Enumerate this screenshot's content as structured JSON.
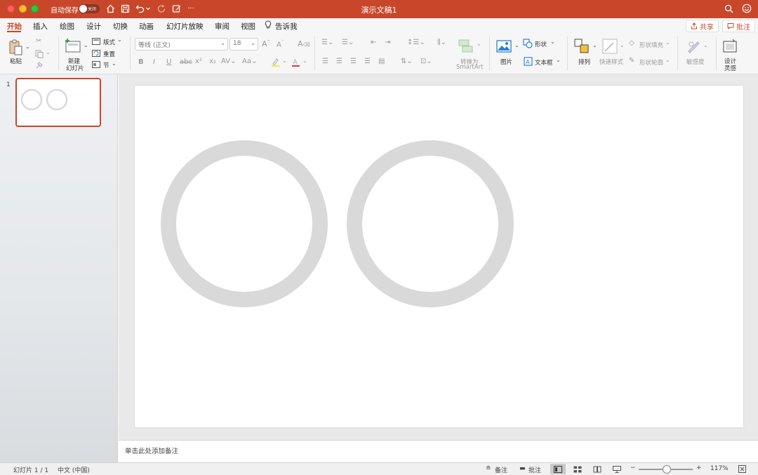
{
  "titlebar": {
    "autosave_label": "自动保存",
    "autosave_state": "关闭",
    "document_title": "演示文稿1",
    "more": "···"
  },
  "tabs": [
    {
      "label": "开始",
      "active": true
    },
    {
      "label": "插入"
    },
    {
      "label": "绘图"
    },
    {
      "label": "设计"
    },
    {
      "label": "切换"
    },
    {
      "label": "动画"
    },
    {
      "label": "幻灯片放映"
    },
    {
      "label": "审阅"
    },
    {
      "label": "视图"
    },
    {
      "label": "告诉我"
    }
  ],
  "actions": {
    "share": "共享",
    "comment": "批注"
  },
  "ribbon": {
    "paste": "粘贴",
    "new_slide_line1": "新建",
    "new_slide_line2": "幻灯片",
    "layout": "版式",
    "reset": "重置",
    "section": "节",
    "font_name": "等线 (正文)",
    "font_size": "18",
    "convert_smartart_line1": "转换为",
    "convert_smartart_line2": "SmartArt",
    "picture": "图片",
    "shapes": "形状",
    "textbox": "文本框",
    "arrange": "排列",
    "quick_styles": "快速样式",
    "shape_fill": "形状填充",
    "shape_outline": "形状轮廓",
    "sensitivity": "敏感度",
    "designer_line1": "设计",
    "designer_line2": "灵感"
  },
  "thumbnails": [
    {
      "number": "1"
    }
  ],
  "notes_placeholder": "单击此处添加备注",
  "statusbar": {
    "slide_info": "幻灯片 1 / 1",
    "language": "中文 (中国)",
    "notes": "备注",
    "comments": "批注",
    "zoom_percent": "117%",
    "zoom_level": 1.17
  },
  "colors": {
    "accent": "#c8472b",
    "circle_stroke": "#d9d9d9"
  }
}
